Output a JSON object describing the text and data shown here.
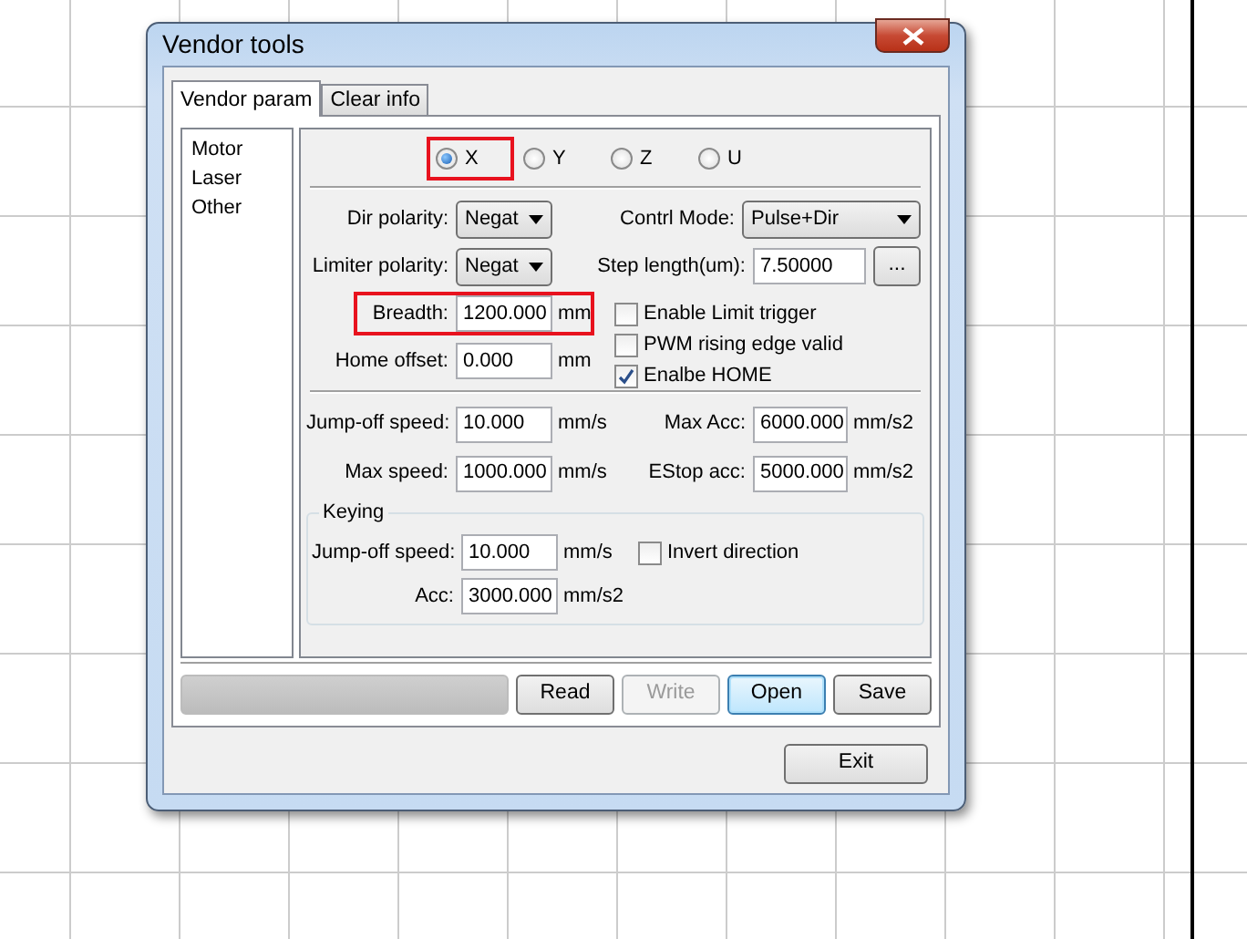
{
  "window": {
    "title": "Vendor tools"
  },
  "tabs": [
    {
      "label": "Vendor param",
      "selected": true
    },
    {
      "label": "Clear info",
      "selected": false
    }
  ],
  "sidebar": {
    "items": [
      {
        "label": "Motor"
      },
      {
        "label": "Laser"
      },
      {
        "label": "Other"
      }
    ]
  },
  "axes": [
    {
      "label": "X",
      "selected": true,
      "highlighted": true
    },
    {
      "label": "Y",
      "selected": false,
      "highlighted": false
    },
    {
      "label": "Z",
      "selected": false,
      "highlighted": false
    },
    {
      "label": "U",
      "selected": false,
      "highlighted": false
    }
  ],
  "axis_left": [
    {
      "label": "Dir polarity:",
      "kind": "select",
      "value": "Negat",
      "highlighted": false
    },
    {
      "label": "Limiter polarity:",
      "kind": "select",
      "value": "Negat",
      "highlighted": false
    },
    {
      "label": "Breadth:",
      "kind": "input",
      "value": "1200.000",
      "unit": "mm",
      "highlighted": true
    },
    {
      "label": "Home offset:",
      "kind": "input",
      "value": "0.000",
      "unit": "mm",
      "highlighted": false
    }
  ],
  "control_mode": {
    "label": "Contrl Mode:",
    "value": "Pulse+Dir"
  },
  "step_length": {
    "label": "Step length(um):",
    "value": "7.50000",
    "button": "..."
  },
  "options": [
    {
      "label": "Enable Limit trigger",
      "checked": false
    },
    {
      "label": "PWM rising edge valid",
      "checked": false
    },
    {
      "label": "Enalbe HOME",
      "checked": true
    }
  ],
  "speeds": [
    {
      "label": "Jump-off speed:",
      "value": "10.000",
      "unit": "mm/s"
    },
    {
      "label": "Max Acc:",
      "value": "6000.000",
      "unit": "mm/s2"
    },
    {
      "label": "Max speed:",
      "value": "1000.000",
      "unit": "mm/s"
    },
    {
      "label": "EStop acc:",
      "value": "5000.000",
      "unit": "mm/s2"
    }
  ],
  "keying": {
    "title": "Keying",
    "jump_off": {
      "label": "Jump-off speed:",
      "value": "10.000",
      "unit": "mm/s"
    },
    "acc": {
      "label": "Acc:",
      "value": "3000.000",
      "unit": "mm/s2"
    },
    "invert": {
      "label": "Invert direction",
      "checked": false
    }
  },
  "progress": {
    "level": 0
  },
  "buttons": [
    {
      "label": "Read",
      "disabled": false,
      "focused": false
    },
    {
      "label": "Write",
      "disabled": true,
      "focused": false
    },
    {
      "label": "Open",
      "disabled": false,
      "focused": true
    },
    {
      "label": "Save",
      "disabled": false,
      "focused": false
    }
  ],
  "exit_button": "Exit"
}
